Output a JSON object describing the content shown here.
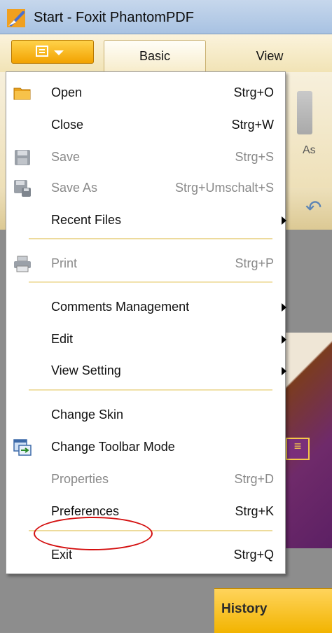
{
  "window": {
    "title": "Start - Foxit PhantomPDF"
  },
  "ribbon": {
    "tabs": [
      {
        "label": "Basic"
      },
      {
        "label": "View"
      }
    ]
  },
  "background": {
    "as_label": "As",
    "history_label": "History"
  },
  "menu": {
    "items": [
      {
        "label": "Open",
        "shortcut": "Strg+O",
        "icon": "folder-icon",
        "enabled": true
      },
      {
        "label": "Close",
        "shortcut": "Strg+W",
        "enabled": true
      },
      {
        "label": "Save",
        "shortcut": "Strg+S",
        "icon": "floppy-icon",
        "enabled": false
      },
      {
        "label": "Save As",
        "shortcut": "Strg+Umschalt+S",
        "icon": "save-as-icon",
        "enabled": false
      },
      {
        "label": "Recent Files",
        "submenu": true,
        "enabled": true
      },
      {
        "label": "Print",
        "shortcut": "Strg+P",
        "icon": "printer-icon",
        "enabled": false
      },
      {
        "label": "Comments Management",
        "submenu": true,
        "enabled": true
      },
      {
        "label": "Edit",
        "submenu": true,
        "enabled": true
      },
      {
        "label": "View Setting",
        "submenu": true,
        "enabled": true
      },
      {
        "label": "Change Skin",
        "enabled": true
      },
      {
        "label": "Change Toolbar Mode",
        "icon": "toolbar-mode-icon",
        "enabled": true
      },
      {
        "label": "Properties",
        "shortcut": "Strg+D",
        "enabled": false
      },
      {
        "label": "Preferences",
        "shortcut": "Strg+K",
        "enabled": true,
        "highlighted": true
      },
      {
        "label": "Exit",
        "shortcut": "Strg+Q",
        "enabled": true
      }
    ]
  },
  "colors": {
    "accent": "#f2a200",
    "highlight_circle": "#d40f0f",
    "separator": "#e9d28a"
  }
}
